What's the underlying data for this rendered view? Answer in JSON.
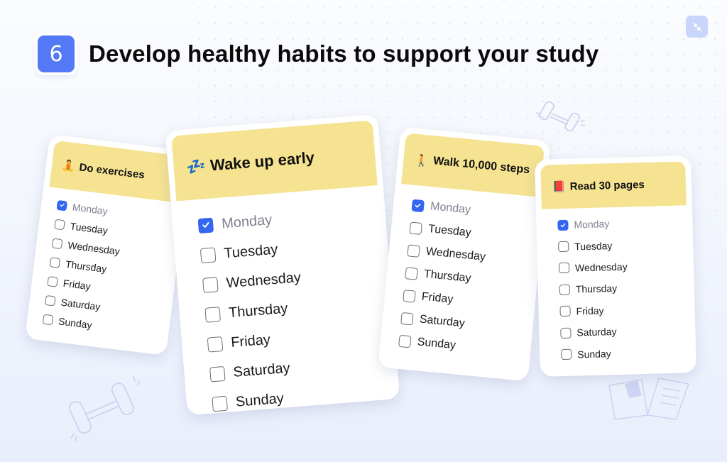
{
  "header": {
    "step_number": "6",
    "title": "Develop healthy habits to support your study"
  },
  "colors": {
    "accent": "#5479f7",
    "card_header": "#f6e391",
    "checkbox_checked": "#3466f0",
    "corner_button": "#c9d5fb"
  },
  "icons": {
    "corner": "collapse-arrows-icon",
    "decor": [
      "dumbbell-icon",
      "dumbbell-icon",
      "open-book-icon"
    ]
  },
  "cards": [
    {
      "title": "Do exercises",
      "emoji": "🧘",
      "emoji_name": "meditation-icon",
      "items": [
        {
          "label": "Monday",
          "checked": true
        },
        {
          "label": "Tuesday",
          "checked": false
        },
        {
          "label": "Wednesday",
          "checked": false
        },
        {
          "label": "Thursday",
          "checked": false
        },
        {
          "label": "Friday",
          "checked": false
        },
        {
          "label": "Saturday",
          "checked": false
        },
        {
          "label": "Sunday",
          "checked": false
        }
      ]
    },
    {
      "title": "Wake up early",
      "emoji": "💤",
      "emoji_name": "zzz-sleep-icon",
      "items": [
        {
          "label": "Monday",
          "checked": true
        },
        {
          "label": "Tuesday",
          "checked": false
        },
        {
          "label": "Wednesday",
          "checked": false
        },
        {
          "label": "Thursday",
          "checked": false
        },
        {
          "label": "Friday",
          "checked": false
        },
        {
          "label": "Saturday",
          "checked": false
        },
        {
          "label": "Sunday",
          "checked": false
        }
      ]
    },
    {
      "title": "Walk 10,000 steps",
      "emoji": "🚶",
      "emoji_name": "walking-person-icon",
      "items": [
        {
          "label": "Monday",
          "checked": true
        },
        {
          "label": "Tuesday",
          "checked": false
        },
        {
          "label": "Wednesday",
          "checked": false
        },
        {
          "label": "Thursday",
          "checked": false
        },
        {
          "label": "Friday",
          "checked": false
        },
        {
          "label": "Saturday",
          "checked": false
        },
        {
          "label": "Sunday",
          "checked": false
        }
      ]
    },
    {
      "title": "Read 30 pages",
      "emoji": "📕",
      "emoji_name": "red-book-icon",
      "items": [
        {
          "label": "Monday",
          "checked": true
        },
        {
          "label": "Tuesday",
          "checked": false
        },
        {
          "label": "Wednesday",
          "checked": false
        },
        {
          "label": "Thursday",
          "checked": false
        },
        {
          "label": "Friday",
          "checked": false
        },
        {
          "label": "Saturday",
          "checked": false
        },
        {
          "label": "Sunday",
          "checked": false
        }
      ]
    }
  ]
}
